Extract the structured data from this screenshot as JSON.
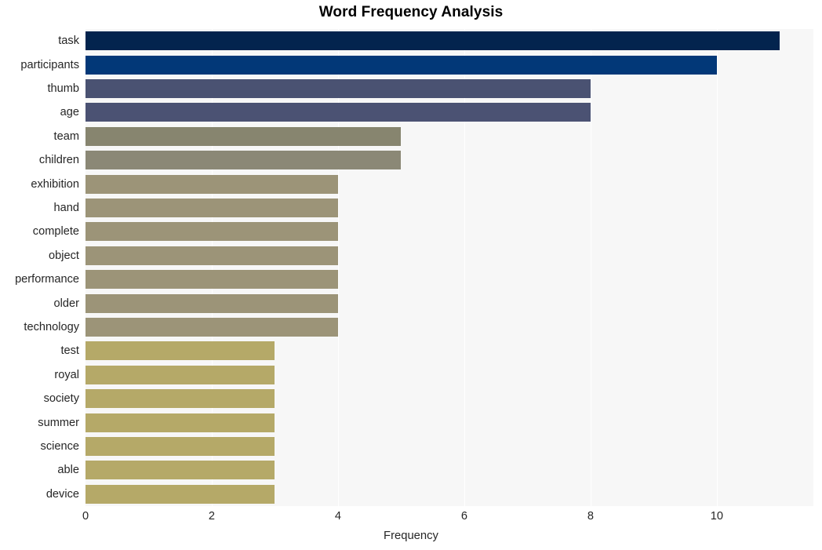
{
  "chart_data": {
    "type": "bar",
    "orientation": "horizontal",
    "title": "Word Frequency Analysis",
    "xlabel": "Frequency",
    "ylabel": "",
    "xlim": [
      0,
      11.53
    ],
    "xticks": [
      0,
      2,
      4,
      6,
      8,
      10
    ],
    "xtick_labels": [
      "0",
      "2",
      "4",
      "6",
      "8",
      "10"
    ],
    "grid": "vertical-white",
    "legend": "none",
    "plot_background": "#f7f7f7",
    "figure_background": "#ffffff",
    "categories": [
      "task",
      "participants",
      "thumb",
      "age",
      "team",
      "children",
      "exhibition",
      "hand",
      "complete",
      "object",
      "performance",
      "older",
      "technology",
      "test",
      "royal",
      "society",
      "summer",
      "science",
      "able",
      "device"
    ],
    "values": [
      11,
      10,
      8,
      8,
      5,
      5,
      4,
      4,
      4,
      4,
      4,
      4,
      4,
      3,
      3,
      3,
      3,
      3,
      3,
      3
    ],
    "bar_colors": [
      "#03244e",
      "#023878",
      "#4a5272",
      "#4b5273",
      "#87856f",
      "#8b8876",
      "#9c9478",
      "#9c9478",
      "#9c9478",
      "#9c9478",
      "#9c9478",
      "#9c9478",
      "#9c9478",
      "#b5a968",
      "#b5a968",
      "#b5a968",
      "#b5a968",
      "#b5a968",
      "#b5a968",
      "#b5a968"
    ],
    "bars": [
      {
        "label": "task",
        "value": 11,
        "color": "#03244e"
      },
      {
        "label": "participants",
        "value": 10,
        "color": "#023878"
      },
      {
        "label": "thumb",
        "value": 8,
        "color": "#4a5272"
      },
      {
        "label": "age",
        "value": 8,
        "color": "#4b5273"
      },
      {
        "label": "team",
        "value": 5,
        "color": "#87856f"
      },
      {
        "label": "children",
        "value": 5,
        "color": "#8b8876"
      },
      {
        "label": "exhibition",
        "value": 4,
        "color": "#9c9478"
      },
      {
        "label": "hand",
        "value": 4,
        "color": "#9c9478"
      },
      {
        "label": "complete",
        "value": 4,
        "color": "#9c9478"
      },
      {
        "label": "object",
        "value": 4,
        "color": "#9c9478"
      },
      {
        "label": "performance",
        "value": 4,
        "color": "#9c9478"
      },
      {
        "label": "older",
        "value": 4,
        "color": "#9c9478"
      },
      {
        "label": "technology",
        "value": 4,
        "color": "#9c9478"
      },
      {
        "label": "test",
        "value": 3,
        "color": "#b5a968"
      },
      {
        "label": "royal",
        "value": 3,
        "color": "#b5a968"
      },
      {
        "label": "society",
        "value": 3,
        "color": "#b5a968"
      },
      {
        "label": "summer",
        "value": 3,
        "color": "#b5a968"
      },
      {
        "label": "science",
        "value": 3,
        "color": "#b5a968"
      },
      {
        "label": "able",
        "value": 3,
        "color": "#b5a968"
      },
      {
        "label": "device",
        "value": 3,
        "color": "#b5a968"
      }
    ]
  }
}
